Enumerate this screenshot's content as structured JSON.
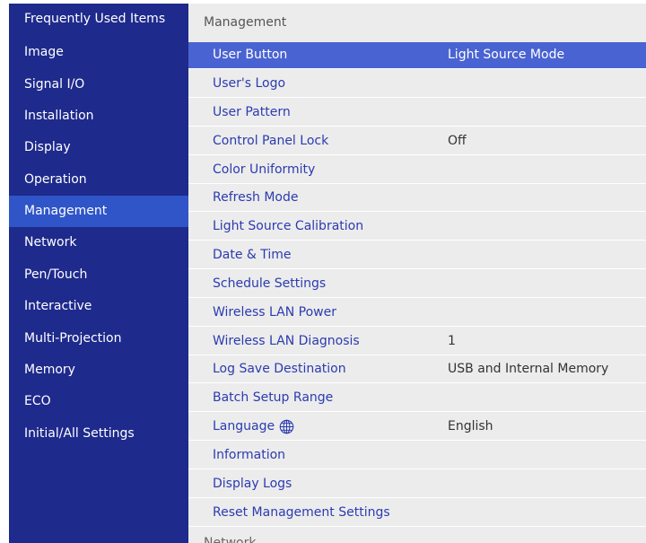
{
  "sidebar": {
    "items": [
      {
        "label": "Frequently Used Items"
      },
      {
        "label": "Image"
      },
      {
        "label": "Signal I/O"
      },
      {
        "label": "Installation"
      },
      {
        "label": "Display"
      },
      {
        "label": "Operation"
      },
      {
        "label": "Management"
      },
      {
        "label": "Network"
      },
      {
        "label": "Pen/Touch"
      },
      {
        "label": "Interactive"
      },
      {
        "label": "Multi-Projection"
      },
      {
        "label": "Memory"
      },
      {
        "label": "ECO"
      },
      {
        "label": "Initial/All Settings"
      }
    ],
    "selected_label": "Management"
  },
  "main": {
    "section_title": "Management",
    "next_section_title": "Network",
    "rows": [
      {
        "label": "User Button",
        "value": "Light Source Mode"
      },
      {
        "label": "User's Logo",
        "value": ""
      },
      {
        "label": "User Pattern",
        "value": ""
      },
      {
        "label": "Control Panel Lock",
        "value": "Off"
      },
      {
        "label": "Color Uniformity",
        "value": ""
      },
      {
        "label": "Refresh Mode",
        "value": ""
      },
      {
        "label": "Light Source Calibration",
        "value": ""
      },
      {
        "label": "Date & Time",
        "value": ""
      },
      {
        "label": "Schedule Settings",
        "value": ""
      },
      {
        "label": "Wireless LAN Power",
        "value": ""
      },
      {
        "label": "Wireless LAN Diagnosis",
        "value": "1"
      },
      {
        "label": "Log Save Destination",
        "value": "USB and Internal Memory"
      },
      {
        "label": "Batch Setup Range",
        "value": ""
      },
      {
        "label": "Language",
        "value": "English",
        "icon": "globe-icon"
      },
      {
        "label": "Information",
        "value": ""
      },
      {
        "label": "Display Logs",
        "value": ""
      },
      {
        "label": "Reset Management Settings",
        "value": ""
      }
    ],
    "selected_label": "User Button"
  },
  "colors": {
    "sidebar_bg": "#1e2a8c",
    "sidebar_selected_bg": "#2f55c8",
    "main_bg": "#ececec",
    "row_selected_bg": "#4a63d2",
    "row_text": "#2b3bb0"
  }
}
